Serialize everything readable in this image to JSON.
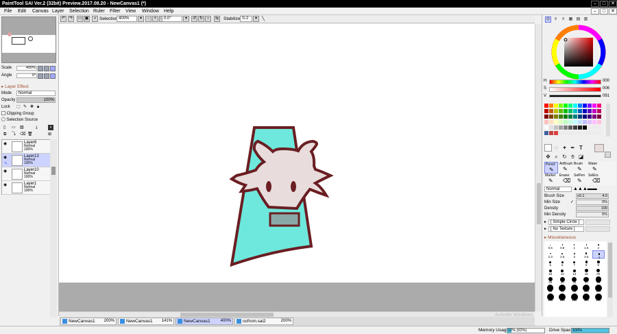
{
  "window": {
    "title": "PaintTool SAI Ver.2 (32bit) Preview.2017.08.20 - NewCanvas1 (*)",
    "close": "✕",
    "maximize": "□",
    "minimize": "–"
  },
  "menu": [
    "File",
    "Edit",
    "Canvas",
    "Layer",
    "Selection",
    "Ruler",
    "Filter",
    "View",
    "Window",
    "Help"
  ],
  "toolbar": {
    "selection_label": "Selection",
    "zoom": "400%",
    "angle": "0.0°",
    "stabilizer_label": "Stabilizer",
    "stabilizer_value": "S-2"
  },
  "navigator": {
    "scale_label": "Scale",
    "scale_value": "400%",
    "angle_label": "Angle",
    "angle_value": "0°"
  },
  "layer_panel": {
    "effect_label": "Layer Effect",
    "mode_label": "Mode",
    "mode_value": "Normal",
    "opacity_label": "Opacity",
    "opacity_value": "100%",
    "lock_label": "Lock",
    "clipping_label": "Clipping Group",
    "selsource_label": "Selection Source",
    "layers": [
      {
        "name": "Layer6",
        "mode": "Normal",
        "opacity": "100%",
        "selected": false
      },
      {
        "name": "Layer13",
        "mode": "Normal",
        "opacity": "100%",
        "selected": true
      },
      {
        "name": "Layer10",
        "mode": "Normal",
        "opacity": "100%",
        "selected": false
      },
      {
        "name": "Layer1",
        "mode": "Normal",
        "opacity": "100%",
        "selected": false
      }
    ]
  },
  "color": {
    "h_label": "H",
    "h_value": "000",
    "s_label": "S",
    "s_value": "006",
    "v_label": "V",
    "v_value": "091",
    "current_color": "#e8dcdc"
  },
  "tools": {
    "row1": [
      "Pencil",
      "AirBrush",
      "Brush",
      "Water"
    ],
    "row2": [
      "Marker",
      "Eraser",
      "SelPen",
      "SelErs"
    ]
  },
  "brush": {
    "mode_value": "Normal",
    "size_label": "Brush Size",
    "size_mult": "x0.1",
    "size_value": "4.0",
    "min_size_label": "Min Size",
    "min_size_value": "0%",
    "density_label": "Density",
    "density_value": "100",
    "min_density_label": "Min Density",
    "min_density_value": "0%",
    "shape_value": "[ Simple Circle ]",
    "texture_value": "[ No Texture ]",
    "misc_label": "Miscellaneous",
    "sizes": [
      "0.6",
      "0.8",
      "1",
      "1.5",
      "2",
      "2.3",
      "2.6",
      "3",
      "3.5",
      "4",
      "5",
      "6",
      "7",
      "8",
      "9",
      "10",
      "12",
      "14",
      "16",
      "20",
      "25",
      "30",
      "35",
      "40",
      "50",
      "60",
      "70",
      "80",
      "100",
      "120",
      "160",
      "200",
      "250",
      "300",
      "350"
    ]
  },
  "tabs": [
    {
      "name": "NewCanvas1",
      "zoom": "200%",
      "active": false
    },
    {
      "name": "NewCanvas1",
      "zoom": "141%",
      "active": false
    },
    {
      "name": "NewCanvas1",
      "zoom": "400%",
      "active": true
    },
    {
      "name": "ocfrom.sai2",
      "zoom": "200%",
      "active": false
    }
  ],
  "status": {
    "memory_label": "Memory Usage",
    "memory_value": "12% (62%)",
    "memory_fraction": 0.12,
    "drive_label": "Drive Space",
    "drive_value": "100%",
    "drive_fraction": 1.0,
    "watermark": "Activate Windows"
  },
  "palette": {
    "primary": "#4a6fe0",
    "selected_layer": "#cdd3ff",
    "outline": "#6a1e22",
    "fur": "#e8dcdc",
    "dress": "#6ee8dc",
    "collar": "#8aa9a6"
  }
}
